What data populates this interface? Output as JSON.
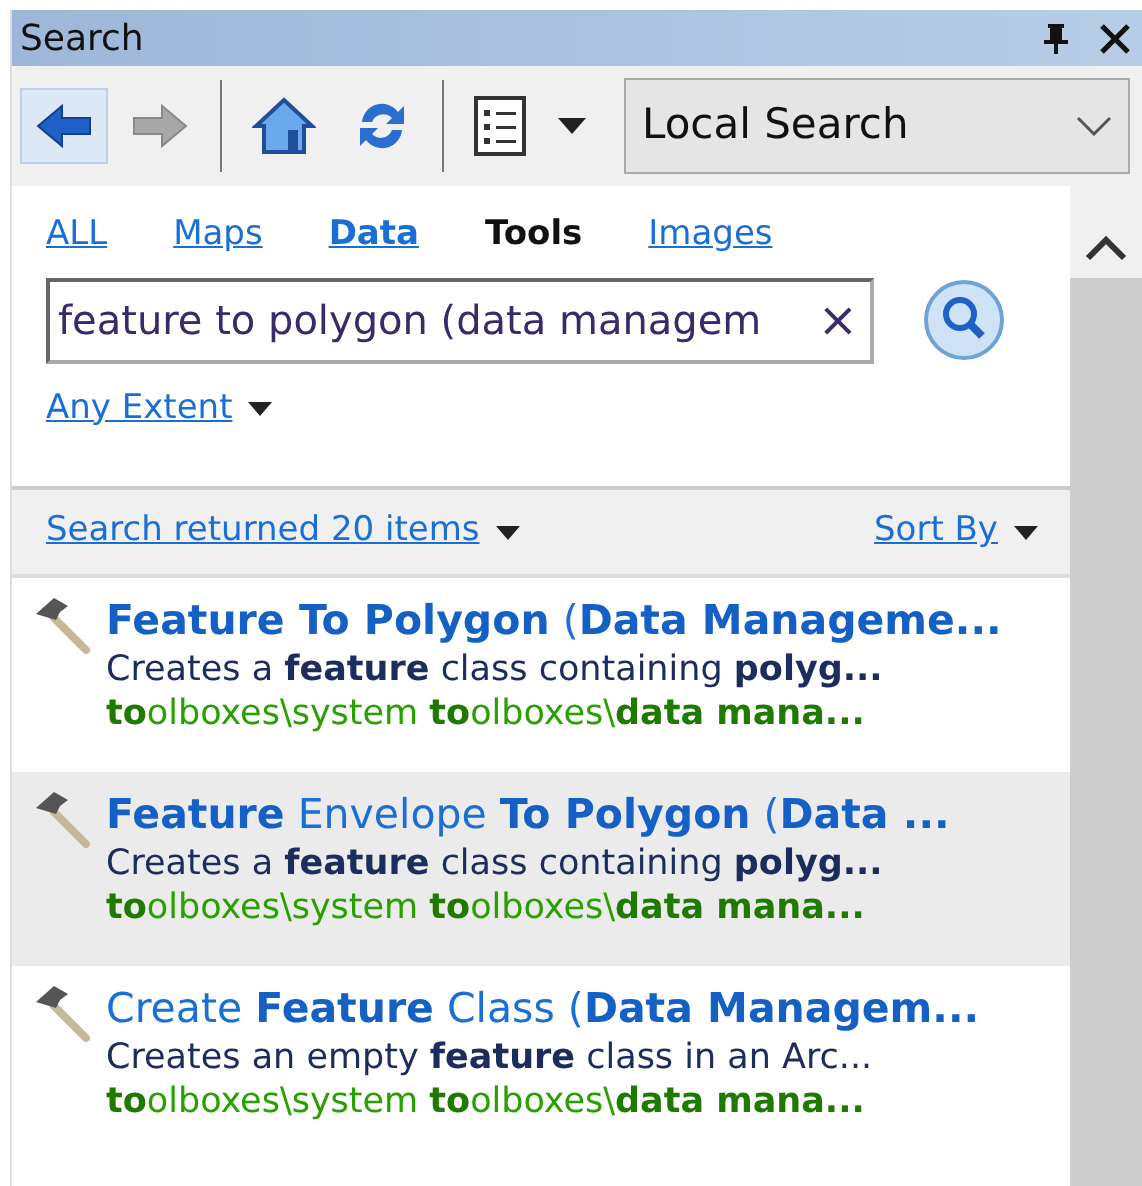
{
  "window": {
    "title": "Search"
  },
  "toolbar": {
    "back_enabled": true,
    "forward_enabled": false,
    "scope": "Local Search"
  },
  "filters": [
    {
      "label": "ALL",
      "selected": false,
      "bold": false
    },
    {
      "label": "Maps",
      "selected": false,
      "bold": false
    },
    {
      "label": "Data",
      "selected": false,
      "bold": true
    },
    {
      "label": "Tools",
      "selected": true,
      "bold": true
    },
    {
      "label": "Images",
      "selected": false,
      "bold": false
    }
  ],
  "search": {
    "value": "feature to polygon (data managem",
    "clear": "×"
  },
  "extent": "Any Extent",
  "results_summary": "Search returned 20 items",
  "sort": "Sort By",
  "results": [
    {
      "title": "**Feature To Polygon** (**Data Manageme...**",
      "description": "Creates a **feature** class containing **polyg...**",
      "path": "**to**olboxes\\system **to**olboxes\\**data mana...**",
      "selected": false
    },
    {
      "title": "**Feature** Envelope **To Polygon** (**Data ...**",
      "description": "Creates a **feature** class containing **polyg...**",
      "path": "**to**olboxes\\system **to**olboxes\\**data mana...**",
      "selected": true
    },
    {
      "title": "Create **Feature** Class (**Data Managem...**",
      "description": "Creates an empty **feature** class in an Arc...",
      "path": "**to**olboxes\\system **to**olboxes\\**data mana...**",
      "selected": false
    }
  ]
}
